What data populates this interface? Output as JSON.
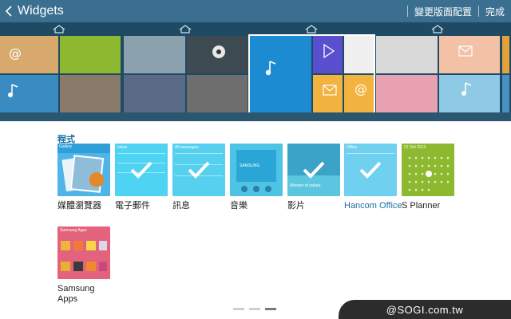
{
  "actionbar": {
    "title": "Widgets",
    "change_layout": "變更版面配置",
    "done": "完成"
  },
  "section": {
    "title": "程式"
  },
  "widgets": [
    {
      "label": "媒體瀏覽器",
      "header": "Gallery"
    },
    {
      "label": "電子郵件",
      "header": "Inbox"
    },
    {
      "label": "訊息",
      "header": "All messages"
    },
    {
      "label": "音樂",
      "header": "SAMSUNG"
    },
    {
      "label": "影片",
      "header": "Wonder of nature"
    },
    {
      "label": "Hancom Office",
      "header": "Office"
    },
    {
      "label": "S Planner",
      "header": "21 Oct 2013"
    },
    {
      "label": "Samsung\nApps",
      "header": "Samsung Apps"
    }
  ],
  "pager": {
    "count": 3,
    "active_index": 2
  },
  "watermark": "@SOGI.com.tw",
  "colors": {
    "actionbar": "#3b6f8f",
    "strip": "#1f4a63",
    "accent": "#1a6fa3",
    "email_tile": "#4fd3f2",
    "music_tile": "#4fc3e6",
    "video_tile": "#5cc6e0",
    "office_tile": "#6fd0ef",
    "planner_tile": "#8cb92f",
    "apps_tile": "#e2637b"
  }
}
